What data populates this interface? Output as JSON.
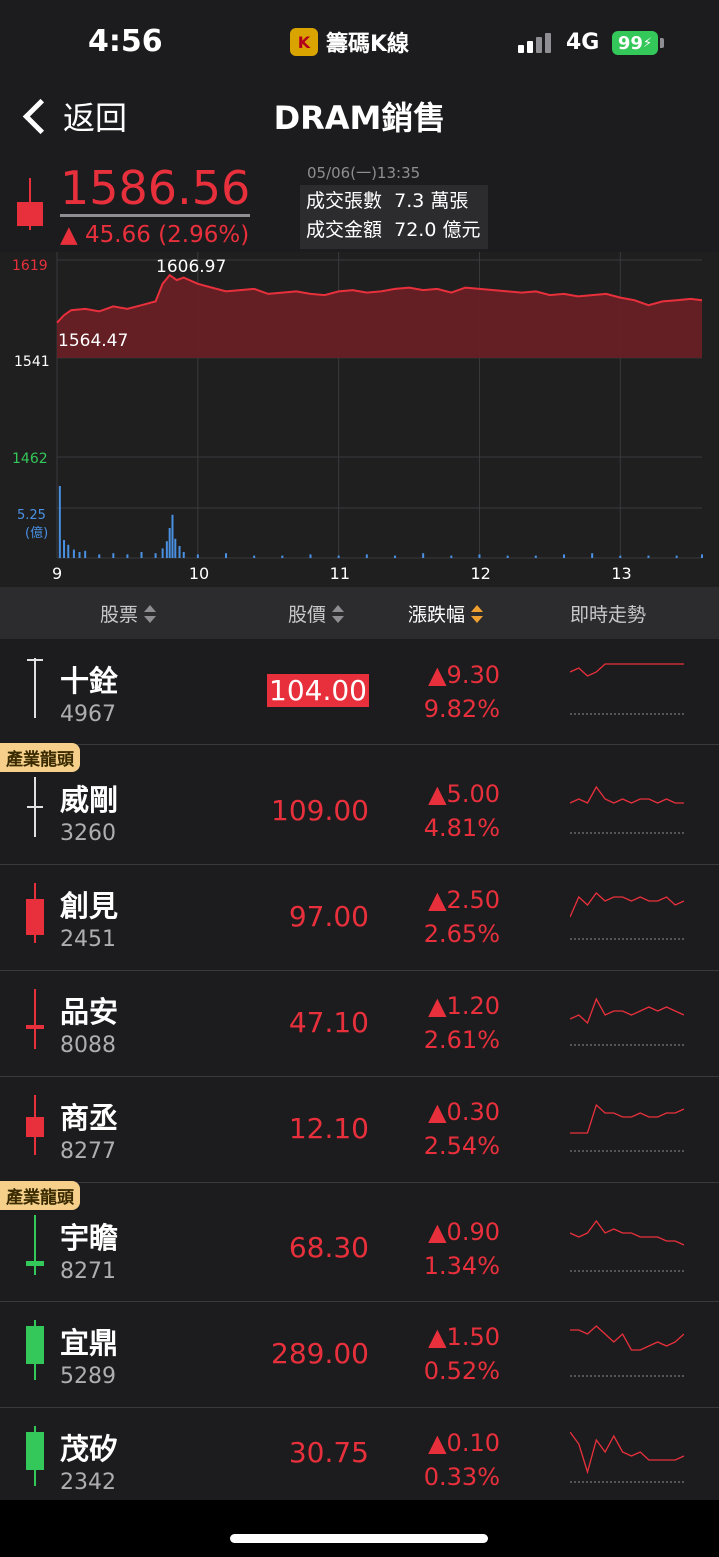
{
  "status_bar": {
    "time": "4:56",
    "app_name": "籌碼K線",
    "app_icon_letter": "K",
    "network": "4G",
    "battery": "99"
  },
  "nav": {
    "back_label": "返回",
    "title": "DRAM銷售"
  },
  "quote": {
    "price": "1586.56",
    "change": "▲ 45.66 (2.96%)",
    "datetime": "05/06(一)13:35",
    "volume_label": "成交張數",
    "volume_value": "7.3 萬張",
    "amount_label": "成交金額",
    "amount_value": "72.0 億元"
  },
  "chart_data": {
    "type": "area",
    "y_ticks": [
      "1619",
      "1541",
      "1462"
    ],
    "volume_tick": "5.25",
    "volume_unit": "(億)",
    "x_ticks": [
      "9",
      "10",
      "11",
      "12",
      "13"
    ],
    "high_label": "1606.97",
    "low_label": "1564.47",
    "ylim": [
      1462,
      1619
    ],
    "reference": 1541,
    "x_range": [
      9,
      13.58
    ],
    "series_time": [
      9.0,
      9.05,
      9.1,
      9.2,
      9.3,
      9.4,
      9.5,
      9.6,
      9.7,
      9.75,
      9.8,
      9.85,
      9.9,
      10.0,
      10.1,
      10.2,
      10.3,
      10.4,
      10.5,
      10.6,
      10.7,
      10.8,
      10.9,
      11.0,
      11.1,
      11.2,
      11.3,
      11.4,
      11.5,
      11.6,
      11.7,
      11.8,
      11.9,
      12.0,
      12.1,
      12.2,
      12.3,
      12.4,
      12.5,
      12.6,
      12.7,
      12.8,
      12.9,
      13.0,
      13.1,
      13.2,
      13.3,
      13.4,
      13.5,
      13.58
    ],
    "series_price": [
      1569,
      1575,
      1579,
      1580,
      1578,
      1582,
      1580,
      1583,
      1586,
      1600,
      1607,
      1603,
      1605,
      1600,
      1597,
      1594,
      1595,
      1596,
      1592,
      1593,
      1594,
      1592,
      1591,
      1594,
      1595,
      1593,
      1594,
      1596,
      1597,
      1595,
      1596,
      1593,
      1597,
      1596,
      1595,
      1594,
      1593,
      1594,
      1591,
      1592,
      1590,
      1591,
      1592,
      1589,
      1587,
      1583,
      1586,
      1587,
      1588,
      1587
    ],
    "volume_time": [
      9.02,
      9.05,
      9.08,
      9.12,
      9.16,
      9.2,
      9.3,
      9.4,
      9.5,
      9.6,
      9.7,
      9.75,
      9.78,
      9.8,
      9.82,
      9.84,
      9.87,
      9.9,
      10.0,
      10.2,
      10.4,
      10.6,
      10.8,
      11.0,
      11.2,
      11.4,
      11.6,
      11.8,
      12.0,
      12.2,
      12.4,
      12.6,
      12.8,
      13.0,
      13.2,
      13.4,
      13.58
    ],
    "volume_values": [
      6.0,
      1.5,
      1.1,
      0.7,
      0.5,
      0.6,
      0.3,
      0.4,
      0.3,
      0.5,
      0.4,
      0.8,
      1.4,
      2.5,
      3.6,
      1.6,
      1.0,
      0.5,
      0.3,
      0.4,
      0.2,
      0.2,
      0.3,
      0.2,
      0.3,
      0.2,
      0.4,
      0.2,
      0.3,
      0.2,
      0.2,
      0.3,
      0.4,
      0.2,
      0.2,
      0.2,
      0.3
    ]
  },
  "table": {
    "headers": {
      "stock": "股票",
      "price": "股價",
      "change": "漲跌幅",
      "trend": "即時走勢"
    },
    "rows": [
      {
        "name": "十銓",
        "code": "4967",
        "price": "104.00",
        "chg": "▲9.30",
        "pct": "9.82%",
        "badge": "",
        "candle_color": "#e0e0e0",
        "candle_type": "line",
        "spark": [
          3,
          2,
          4,
          3,
          1,
          1,
          1,
          1,
          1,
          1,
          1,
          1,
          1,
          1
        ]
      },
      {
        "name": "威剛",
        "code": "3260",
        "price": "109.00",
        "chg": "▲5.00",
        "pct": "4.81%",
        "badge": "產業龍頭",
        "candle_color": "#e0e0e0",
        "candle_type": "cross",
        "spark": [
          6,
          5,
          6,
          2,
          5,
          6,
          5,
          6,
          5,
          5,
          6,
          5,
          6,
          6
        ]
      },
      {
        "name": "創見",
        "code": "2451",
        "price": "97.00",
        "chg": "▲2.50",
        "pct": "2.65%",
        "badge": "",
        "candle_color": "#e8303c",
        "candle_type": "solid",
        "spark": [
          8,
          3,
          5,
          2,
          4,
          3,
          3,
          4,
          3,
          4,
          4,
          3,
          5,
          4
        ]
      },
      {
        "name": "品安",
        "code": "8088",
        "price": "47.10",
        "chg": "▲1.20",
        "pct": "2.61%",
        "badge": "",
        "candle_color": "#e8303c",
        "candle_type": "thin",
        "spark": [
          7,
          6,
          8,
          2,
          6,
          5,
          5,
          6,
          5,
          4,
          5,
          4,
          5,
          6
        ]
      },
      {
        "name": "商丞",
        "code": "8277",
        "price": "12.10",
        "chg": "▲0.30",
        "pct": "2.54%",
        "badge": "",
        "candle_color": "#e8303c",
        "candle_type": "mid",
        "spark": [
          9,
          9,
          9,
          2,
          4,
          4,
          5,
          5,
          4,
          5,
          5,
          4,
          4,
          3
        ]
      },
      {
        "name": "宇瞻",
        "code": "8271",
        "price": "68.30",
        "chg": "▲0.90",
        "pct": "1.34%",
        "badge": "產業龍頭",
        "candle_color": "#34c759",
        "candle_type": "hammer",
        "spark": [
          4,
          5,
          4,
          1,
          4,
          3,
          4,
          4,
          5,
          5,
          5,
          6,
          6,
          7
        ]
      },
      {
        "name": "宜鼎",
        "code": "5289",
        "price": "289.00",
        "chg": "▲1.50",
        "pct": "0.52%",
        "badge": "",
        "candle_color": "#34c759",
        "candle_type": "solidg",
        "spark": [
          2,
          2,
          3,
          1,
          3,
          5,
          3,
          7,
          7,
          6,
          5,
          6,
          5,
          3
        ]
      },
      {
        "name": "茂矽",
        "code": "2342",
        "price": "30.75",
        "chg": "▲0.10",
        "pct": "0.33%",
        "badge": "",
        "candle_color": "#34c759",
        "candle_type": "solidg",
        "spark": [
          1,
          4,
          11,
          3,
          6,
          2,
          6,
          7,
          6,
          8,
          8,
          8,
          8,
          7
        ]
      }
    ]
  }
}
